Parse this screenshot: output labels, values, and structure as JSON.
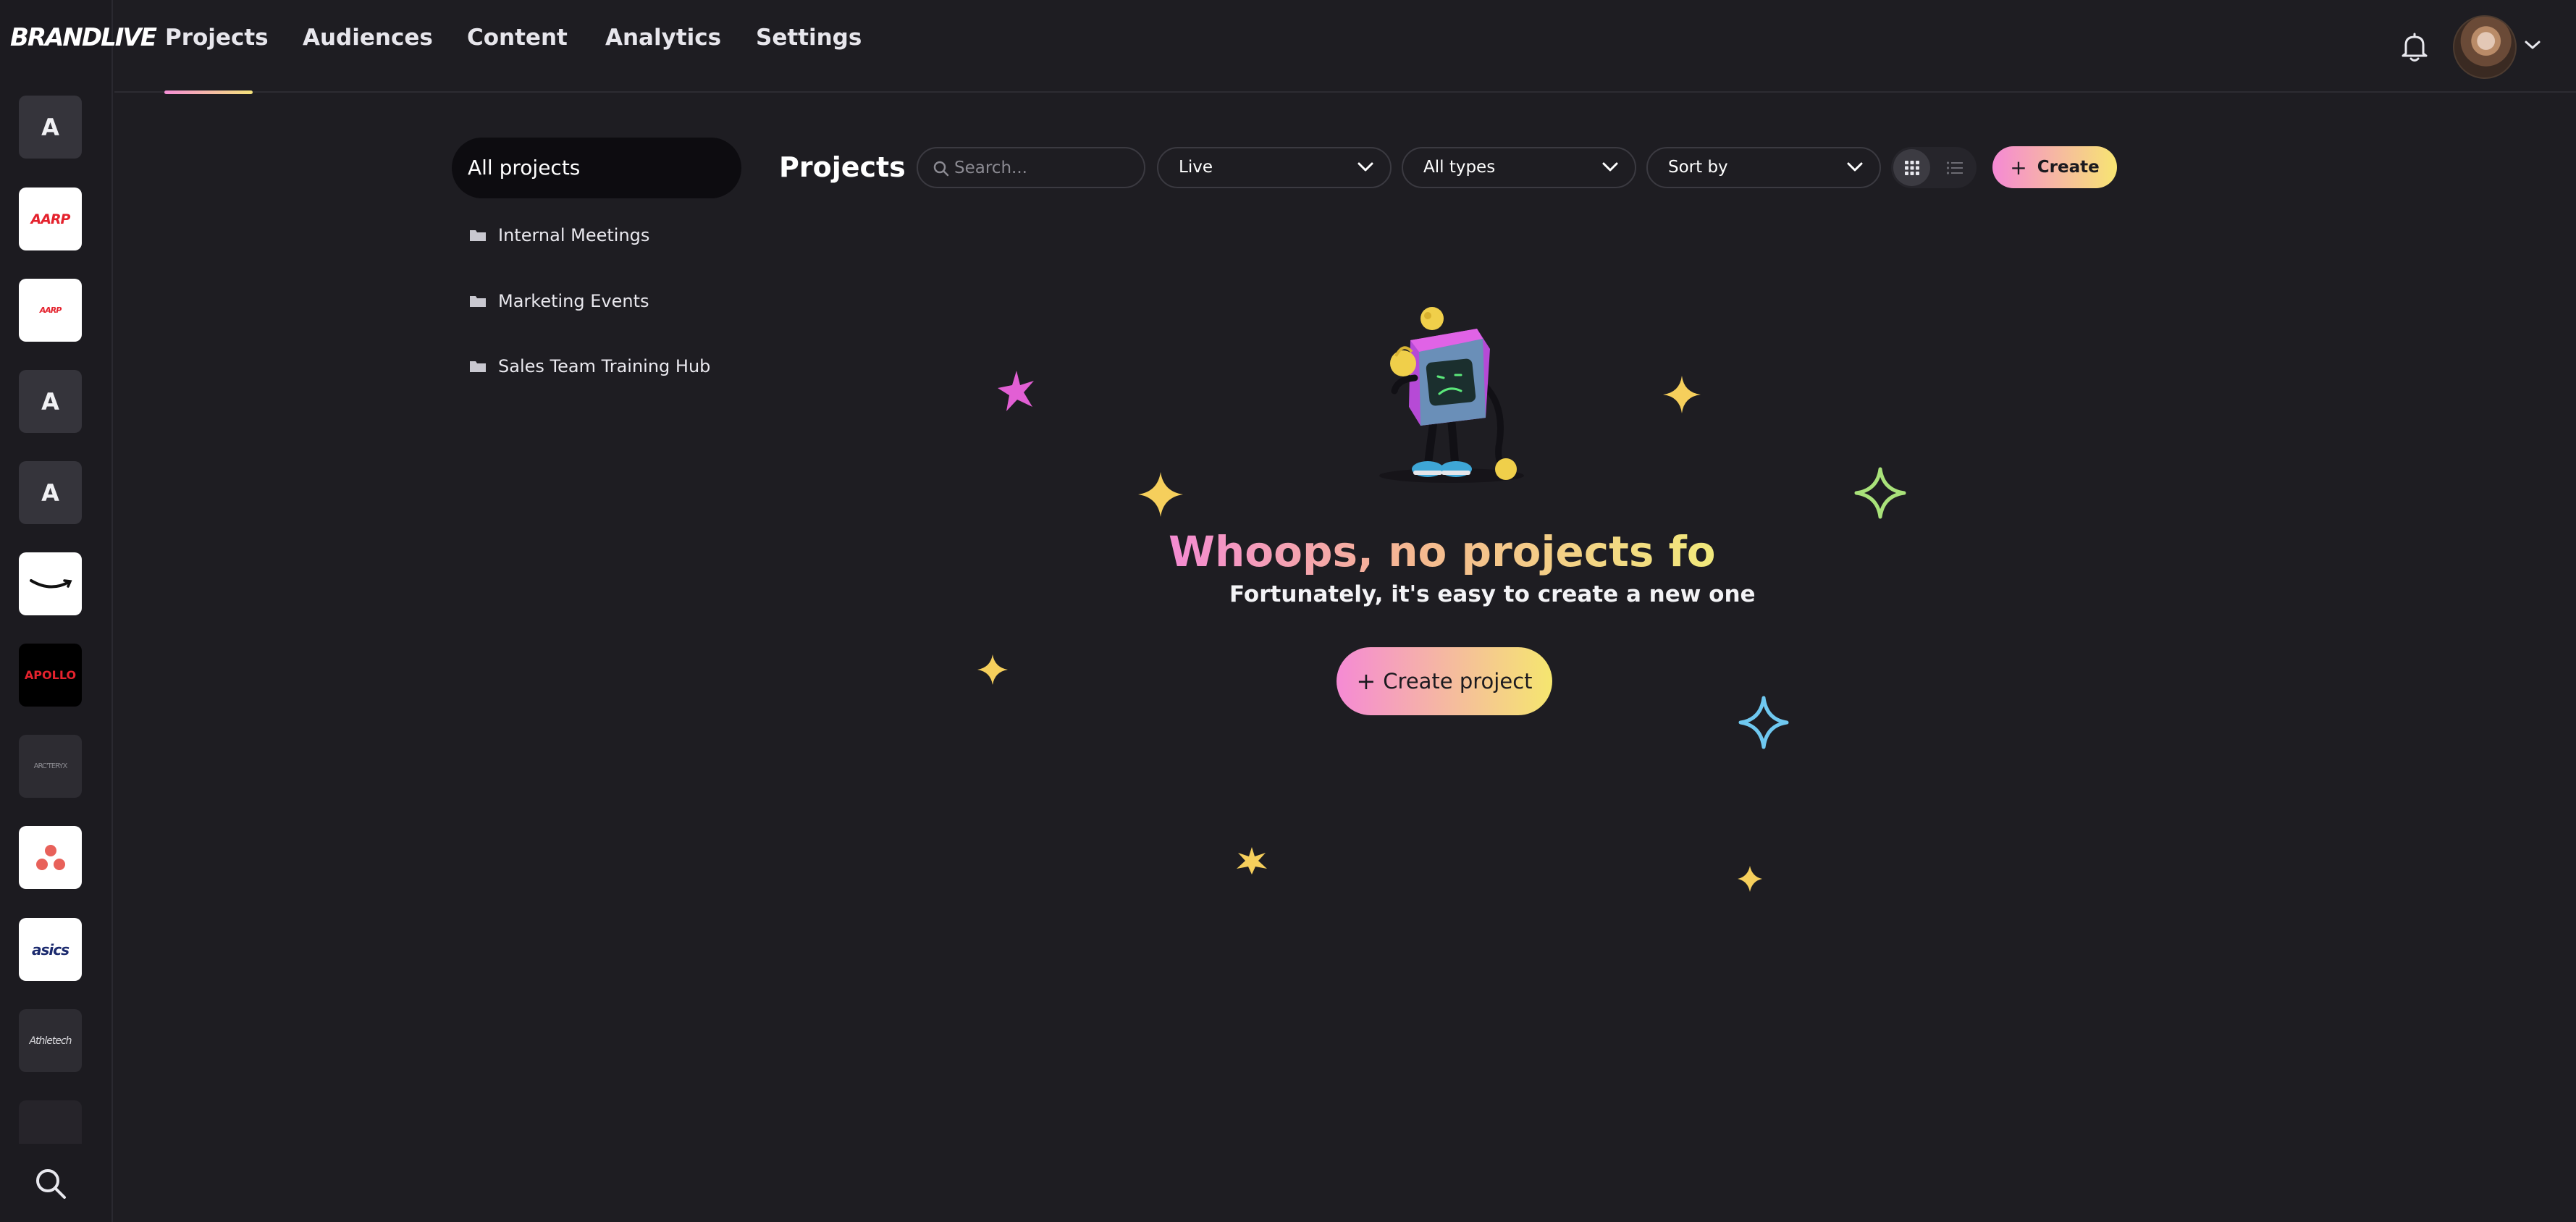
{
  "brand": {
    "logo_text": "BRANDLIVE"
  },
  "rail": {
    "tiles": [
      {
        "name": "workspace-a-1",
        "text": "A",
        "style": "letter"
      },
      {
        "name": "workspace-aarp",
        "text": "AARP",
        "style": "white-aarp"
      },
      {
        "name": "workspace-aarp-small",
        "text": "AARP",
        "style": "white-aarp-small"
      },
      {
        "name": "workspace-a-2",
        "text": "A",
        "style": "letter"
      },
      {
        "name": "workspace-a-3",
        "text": "A",
        "style": "letter"
      },
      {
        "name": "workspace-amazon",
        "text": "",
        "style": "white-amazon"
      },
      {
        "name": "workspace-apollo",
        "text": "APOLLO",
        "style": "black-apollo"
      },
      {
        "name": "workspace-arcteryx",
        "text": "ARC'TERYX",
        "style": "grey-arc"
      },
      {
        "name": "workspace-asana",
        "text": "",
        "style": "white-asana"
      },
      {
        "name": "workspace-asics",
        "text": "asics",
        "style": "white-asics"
      },
      {
        "name": "workspace-athletech",
        "text": "Athletech",
        "style": "grey-athl"
      }
    ]
  },
  "nav": {
    "tabs": [
      {
        "label": "Projects",
        "active": true
      },
      {
        "label": "Audiences",
        "active": false
      },
      {
        "label": "Content",
        "active": false
      },
      {
        "label": "Analytics",
        "active": false
      },
      {
        "label": "Settings",
        "active": false
      }
    ]
  },
  "sidebar": {
    "all_projects": "All projects",
    "folders": [
      {
        "label": "Internal Meetings"
      },
      {
        "label": "Marketing Events"
      },
      {
        "label": "Sales Team Training Hub"
      }
    ]
  },
  "toolbar": {
    "title": "Projects",
    "search_placeholder": "Search...",
    "status_filter": "Live",
    "type_filter": "All types",
    "sort": "Sort by",
    "view_mode": "grid",
    "create_label": "Create"
  },
  "empty_state": {
    "headline": "Whoops, no projects found!",
    "subline": "Fortunately, it's easy to create a new one",
    "button_label": "Create project"
  },
  "colors": {
    "background": "#1e1d22",
    "gradient_pink": "#f58ad4",
    "gradient_yellow": "#f5e66f",
    "sparkle_gold": "#f6cf5c",
    "sparkle_pink": "#e25fd4",
    "sparkle_green": "#a9e27a",
    "sparkle_blue": "#6fc8f0"
  }
}
